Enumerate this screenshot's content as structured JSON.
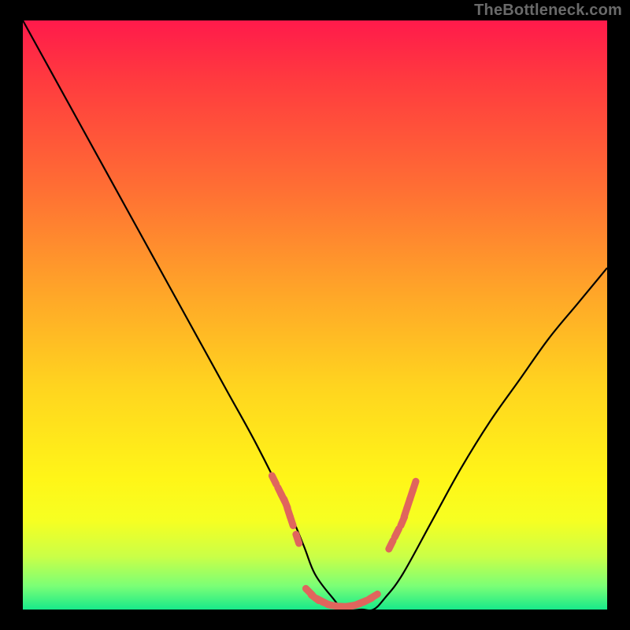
{
  "watermark": "TheBottleneck.com",
  "chart_data": {
    "type": "line",
    "title": "",
    "xlabel": "",
    "ylabel": "",
    "xlim": [
      0,
      100
    ],
    "ylim": [
      0,
      100
    ],
    "series": [
      {
        "name": "bottleneck-curve",
        "color": "#000000",
        "x": [
          0,
          5,
          10,
          15,
          20,
          25,
          30,
          35,
          40,
          45,
          48,
          50,
          53,
          55,
          58,
          60,
          62,
          65,
          70,
          75,
          80,
          85,
          90,
          95,
          100
        ],
        "y": [
          100,
          91,
          82,
          73,
          64,
          55,
          46,
          37,
          28,
          18,
          11,
          6,
          2,
          0,
          0,
          0,
          2,
          6,
          15,
          24,
          32,
          39,
          46,
          52,
          58
        ]
      }
    ],
    "markers": [
      {
        "name": "left-cluster",
        "color": "#e0655d",
        "x": [
          43,
          44,
          44.5,
          45,
          45.5,
          46,
          47
        ],
        "y": [
          22,
          20,
          19,
          18,
          16.5,
          15,
          12
        ]
      },
      {
        "name": "bottom-cluster",
        "color": "#e0655d",
        "x": [
          49,
          50,
          51,
          52,
          53,
          55,
          56,
          57,
          58,
          59,
          60
        ],
        "y": [
          3,
          2,
          1.5,
          1,
          0.7,
          0.5,
          0.6,
          0.8,
          1.2,
          1.6,
          2.2
        ]
      },
      {
        "name": "right-cluster",
        "color": "#e0655d",
        "x": [
          63,
          64,
          65,
          65.5,
          66,
          66.5,
          67
        ],
        "y": [
          11,
          13,
          15,
          16.5,
          18,
          19.5,
          21
        ]
      }
    ]
  }
}
